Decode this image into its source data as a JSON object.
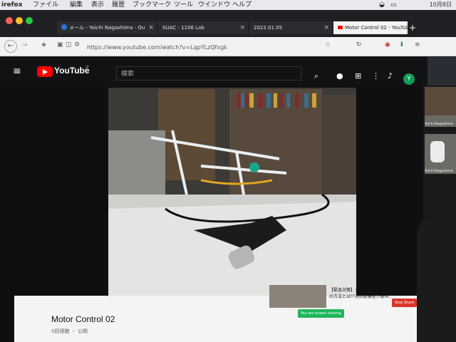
{
  "menubar": {
    "app": "irefox",
    "items": [
      "ファイル",
      "編集",
      "表示",
      "履歴",
      "ブックマーク",
      "ツール",
      "ウインドウ",
      "ヘルプ"
    ],
    "clock": "10月8日"
  },
  "tabs": [
    {
      "label": "メール - Yoichi Nagashima - Ou"
    },
    {
      "label": "SUAC - 1106 Lab"
    },
    {
      "label": "2022.01.05"
    },
    {
      "label": "Motor Control 02 - YouTube"
    }
  ],
  "url": "https://www.youtube.com/watch?v=LqpYLzQfxgk",
  "youtube": {
    "brand": "YouTube",
    "region": "JP",
    "search_placeholder": "検索",
    "avatar_letter": "Y"
  },
  "video": {
    "title": "Motor Control 02",
    "subtitle": "0回視聴 ・ 公開"
  },
  "suggestion": {
    "line1": "【緊急対策】火事で生き残る唯一",
    "line2": "の方法とは!?消防経験者が教科..."
  },
  "meeting": {
    "participants": [
      "Yoichi Nagashima",
      "Yoichi Nagashima"
    ],
    "stop_share": "Stop Share",
    "sharing_label": "You are screen sharing"
  },
  "colors": {
    "yt_red": "#ff0000",
    "dark_bg": "#0f0f11",
    "share_green": "#1fb65b",
    "stop_red": "#d9342b"
  }
}
